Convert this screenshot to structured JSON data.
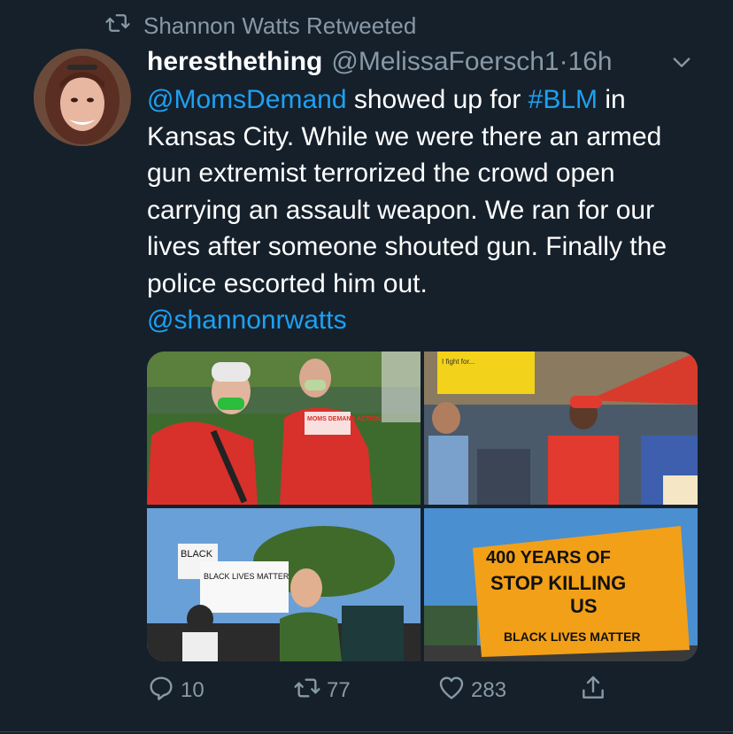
{
  "retweet_notice": "Shannon Watts Retweeted",
  "tweet": {
    "display_name": "heresthething",
    "handle": "@MelissaFoersch1",
    "separator": "·",
    "time": "16h",
    "mention1": "@MomsDemand",
    "text1": " showed up for ",
    "hashtag": "#BLM",
    "text2": " in Kansas City. While we were there an armed gun extremist terrorized the crowd open carrying an assault weapon. We ran for our lives after someone shouted gun. Finally the police escorted him out.",
    "mention2": "@shannonrwatts"
  },
  "photos": {
    "p1_shirt": "MOMS DEMAND ACTION",
    "p2_sign": "I fight for...",
    "p3_sign_a": "BLACK",
    "p3_sign_b": "BLACK LIVES MATTER",
    "p4_sign_line1": "400 YEARS OF",
    "p4_sign_line2": "STOP KILLING",
    "p4_sign_line3": "US",
    "p4_sign_line4": "BLACK LIVES MATTER"
  },
  "actions": {
    "replies": "10",
    "retweets": "77",
    "likes": "283"
  },
  "colors": {
    "background": "#15202b",
    "link": "#1da1f2",
    "secondary": "#8899a6"
  },
  "icons": [
    "retweet-icon",
    "caret-down-icon",
    "reply-icon",
    "retweet-icon",
    "heart-icon",
    "share-icon"
  ]
}
